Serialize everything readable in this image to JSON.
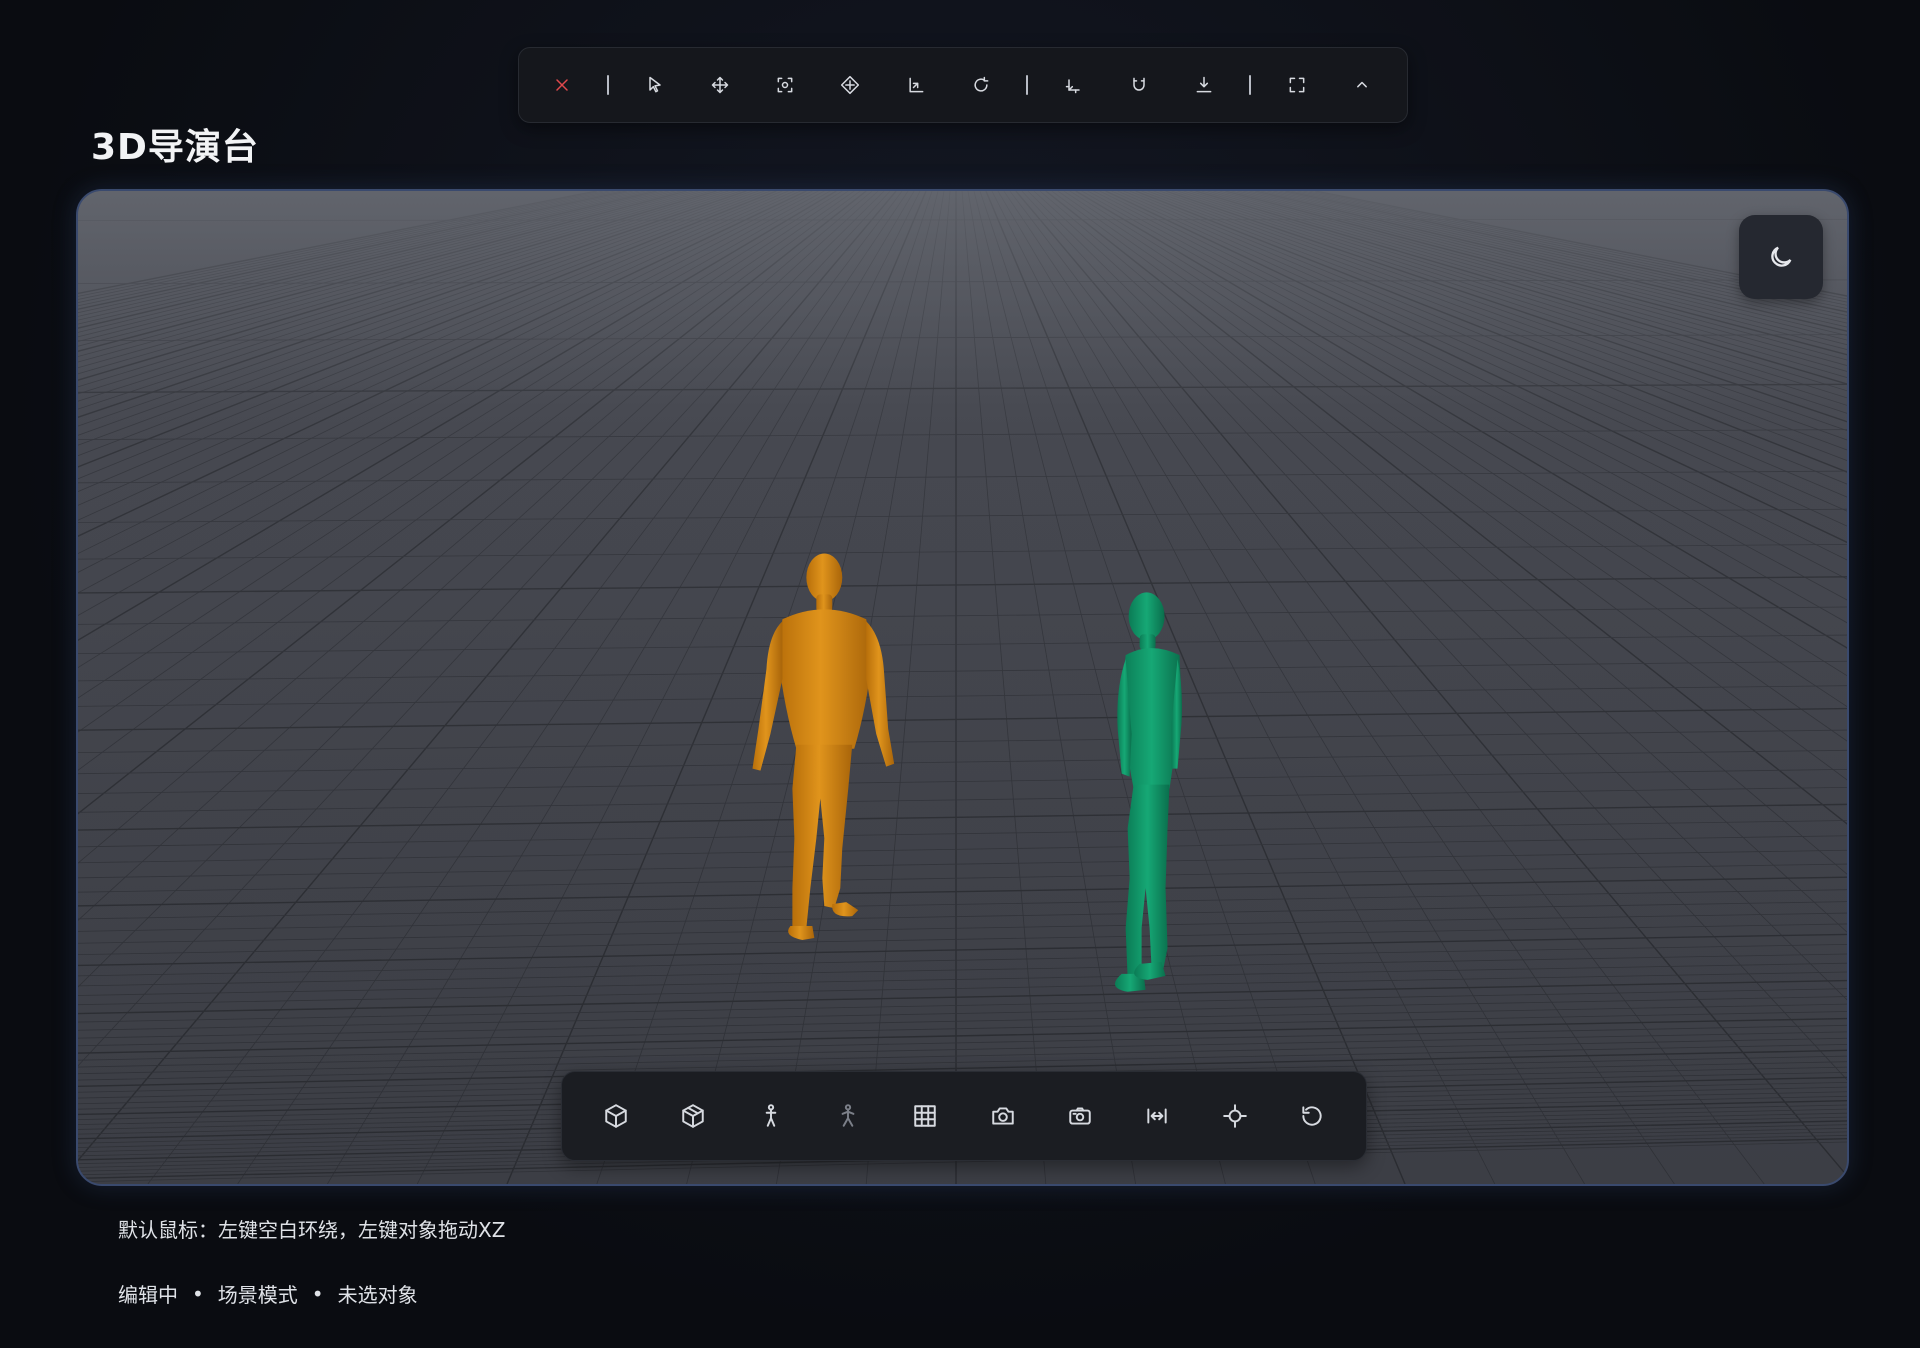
{
  "page": {
    "title": "3D导演台"
  },
  "colors": {
    "accent_close": "#e0484c",
    "figure_orange": "#d6860f",
    "figure_green": "#12a06f",
    "viewport_border": "#3a4a6e"
  },
  "top_toolbar": {
    "items": [
      {
        "icon": "close-icon"
      },
      {
        "separator": true
      },
      {
        "icon": "pointer-icon"
      },
      {
        "icon": "move-icon"
      },
      {
        "icon": "focus-icon"
      },
      {
        "icon": "transform-icon"
      },
      {
        "icon": "axis-icon"
      },
      {
        "icon": "rotate-icon"
      },
      {
        "separator": true
      },
      {
        "icon": "coordinate-icon"
      },
      {
        "icon": "magnet-icon"
      },
      {
        "icon": "drop-to-floor-icon"
      },
      {
        "separator": true
      },
      {
        "icon": "fullscreen-icon"
      },
      {
        "icon": "chevron-up-icon"
      }
    ]
  },
  "viewport": {
    "theme_toggle_icon": "moon-icon",
    "figures": [
      {
        "name": "orange-figure",
        "color": "#d6860f"
      },
      {
        "name": "green-figure",
        "color": "#12a06f"
      }
    ]
  },
  "bottom_toolbar": {
    "items": [
      {
        "icon": "cube-outline-icon"
      },
      {
        "icon": "cube-icon"
      },
      {
        "icon": "person-icon"
      },
      {
        "icon": "person-dim-icon"
      },
      {
        "icon": "grid-icon"
      },
      {
        "icon": "camera-icon"
      },
      {
        "icon": "camera-alt-icon"
      },
      {
        "icon": "width-icon"
      },
      {
        "icon": "crosshair-icon"
      },
      {
        "icon": "reset-icon"
      }
    ]
  },
  "footer": {
    "hint": "默认鼠标：左键空白环绕，左键对象拖动XZ",
    "status": [
      "编辑中",
      "场景模式",
      "未选对象"
    ],
    "separator": "•"
  }
}
